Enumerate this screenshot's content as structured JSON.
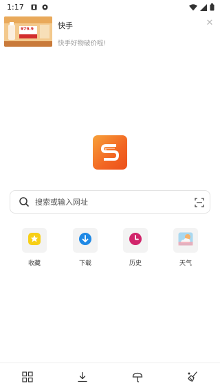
{
  "status_bar": {
    "time": "1:17",
    "icons_left": [
      "notification-icon",
      "location-icon"
    ],
    "icons_right": [
      "wifi-icon",
      "cellular-icon",
      "battery-icon"
    ]
  },
  "notification": {
    "title": "快手",
    "subtitle": "快手好物破价啦!",
    "thumbnail_text": "¥79.9",
    "close_glyph": "✕"
  },
  "logo": {
    "icon": "browser-logo-icon",
    "color": "#f26522"
  },
  "search": {
    "placeholder": "搜索或输入网址",
    "icon": "search-icon",
    "right_icon": "scan-icon"
  },
  "shortcuts": [
    {
      "label": "收藏",
      "icon": "star-icon",
      "color": "#f7cf16"
    },
    {
      "label": "下载",
      "icon": "download-icon",
      "color": "#1e88e5"
    },
    {
      "label": "历史",
      "icon": "clock-icon",
      "color": "#d1256b"
    },
    {
      "label": "天气",
      "icon": "weather-icon",
      "color": "#f0a6a0"
    }
  ],
  "bottom_bar": {
    "items": [
      "grid-icon",
      "download-icon",
      "umbrella-icon",
      "broom-icon"
    ]
  }
}
